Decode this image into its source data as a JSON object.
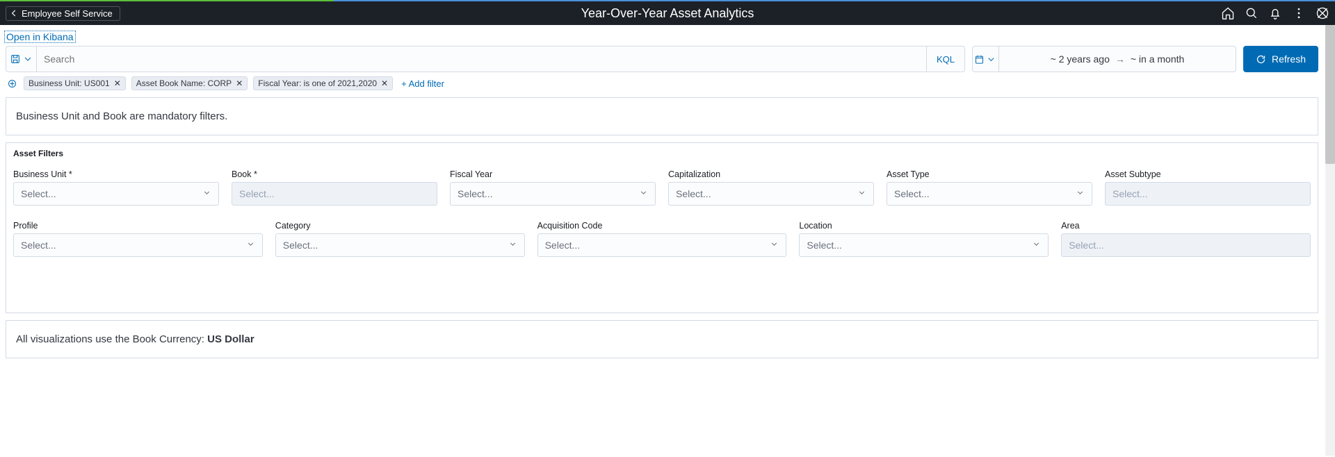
{
  "accent": "#006bb4",
  "header": {
    "back_label": "Employee Self Service",
    "title": "Year-Over-Year Asset Analytics",
    "icons": [
      "home-icon",
      "search-icon",
      "bell-icon",
      "more-vertical-icon",
      "compass-icon"
    ]
  },
  "kibana_link": "Open in Kibana",
  "query_bar": {
    "search_placeholder": "Search",
    "kql_label": "KQL",
    "date_from": "~ 2 years ago",
    "date_to": "~ in a month",
    "refresh_label": "Refresh"
  },
  "filter_chips": [
    {
      "label": "Business Unit: US001"
    },
    {
      "label": "Asset Book Name: CORP"
    },
    {
      "label": "Fiscal Year: is one of 2021,2020"
    }
  ],
  "add_filter_label": "+ Add filter",
  "mandatory_msg": "Business Unit and Book are mandatory filters.",
  "asset_filters": {
    "title": "Asset Filters",
    "select_placeholder": "Select...",
    "row1": [
      {
        "label": "Business Unit *",
        "disabled": false,
        "chevron": true
      },
      {
        "label": "Book *",
        "disabled": true,
        "chevron": false
      },
      {
        "label": "Fiscal Year",
        "disabled": false,
        "chevron": true
      },
      {
        "label": "Capitalization",
        "disabled": false,
        "chevron": true
      },
      {
        "label": "Asset Type",
        "disabled": false,
        "chevron": true
      },
      {
        "label": "Asset Subtype",
        "disabled": true,
        "chevron": false
      }
    ],
    "row2": [
      {
        "label": "Profile",
        "disabled": false,
        "chevron": true
      },
      {
        "label": "Category",
        "disabled": false,
        "chevron": true
      },
      {
        "label": "Acquisition Code",
        "disabled": false,
        "chevron": true
      },
      {
        "label": "Location",
        "disabled": false,
        "chevron": true
      },
      {
        "label": "Area",
        "disabled": true,
        "chevron": false
      }
    ]
  },
  "currency_note": {
    "prefix": "All visualizations use the Book Currency: ",
    "value": "US Dollar"
  }
}
